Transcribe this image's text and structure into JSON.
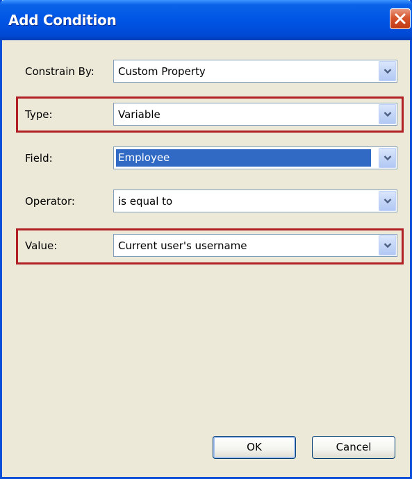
{
  "window": {
    "title": "Add Condition"
  },
  "form": {
    "constrain_by": {
      "label": "Constrain By:",
      "value": "Custom Property"
    },
    "type": {
      "label": "Type:",
      "value": "Variable"
    },
    "field": {
      "label": "Field:",
      "value": "Employee"
    },
    "operator": {
      "label": "Operator:",
      "value": "is equal to"
    },
    "value": {
      "label": "Value:",
      "value": "Current user's username"
    }
  },
  "buttons": {
    "ok": "OK",
    "cancel": "Cancel"
  },
  "colors": {
    "highlight_border": "#b01f24",
    "titlebar": "#0055e5",
    "selection": "#316ac5"
  },
  "icons": {
    "close": "close-icon",
    "dropdown": "chevron-down-icon"
  }
}
